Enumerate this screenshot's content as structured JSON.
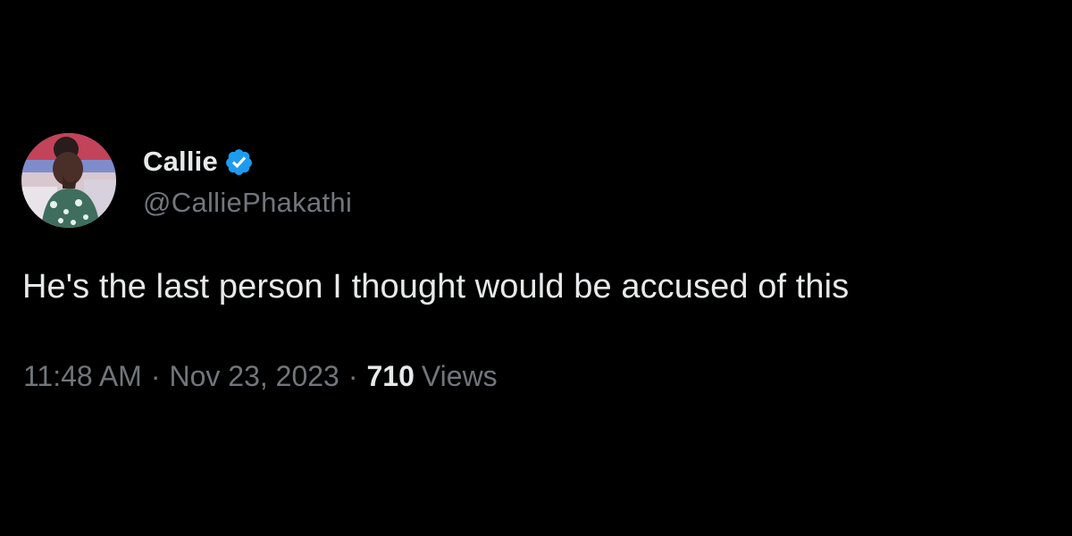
{
  "tweet": {
    "author": {
      "display_name": "Callie",
      "handle": "@CalliePhakathi",
      "verified": true,
      "verified_badge_color": "#1d9bf0"
    },
    "text": "He's the last person I thought would be accused of this",
    "time": "11:48 AM",
    "separator": "·",
    "date": "Nov 23, 2023",
    "views_count": "710",
    "views_label": "Views"
  },
  "colors": {
    "background": "#000000",
    "primary_text": "#e7e9ea",
    "secondary_text": "#71767b"
  }
}
